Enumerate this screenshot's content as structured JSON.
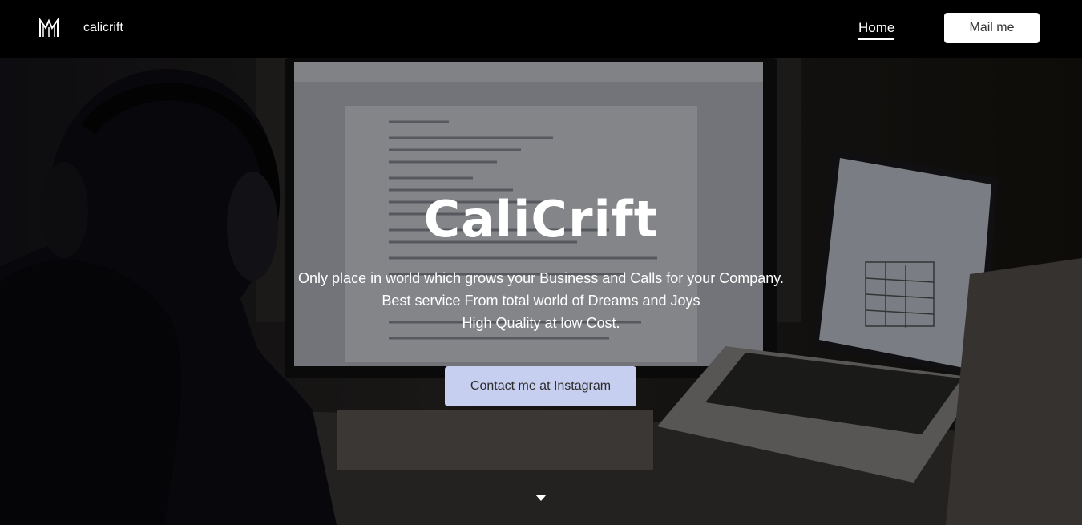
{
  "header": {
    "brand_name": "calicrift",
    "nav_home": "Home",
    "mail_button": "Mail me"
  },
  "hero": {
    "title": "CaliCrift",
    "lines": [
      "Only place in world which grows your Business and Calls for your Company.",
      "Best service From total world of Dreams and Joys",
      "High Quality at low Cost."
    ],
    "contact_button": "Contact me at Instagram"
  },
  "colors": {
    "header_bg": "#000000",
    "contact_button_bg": "#c7cff0",
    "text": "#ffffff"
  },
  "icons": [
    "brand-logo-icon",
    "scroll-down-icon"
  ]
}
